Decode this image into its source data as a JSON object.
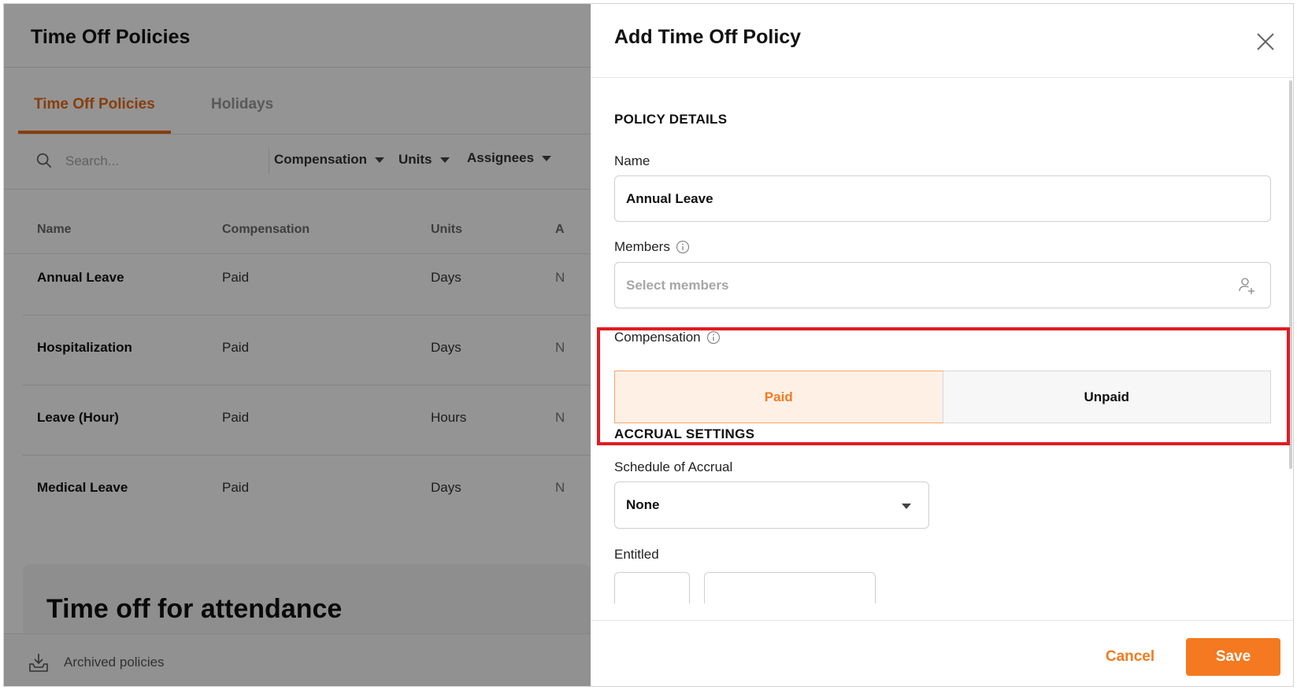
{
  "page": {
    "title": "Time Off Policies",
    "tabs": [
      {
        "label": "Time Off Policies",
        "active": true
      },
      {
        "label": "Holidays",
        "active": false
      }
    ],
    "search_placeholder": "Search...",
    "filters": [
      "Compensation",
      "Units",
      "Assignees"
    ],
    "table": {
      "columns": [
        "Name",
        "Compensation",
        "Units",
        "A"
      ],
      "rows": [
        {
          "name": "Annual Leave",
          "compensation": "Paid",
          "units": "Days",
          "more": "N"
        },
        {
          "name": "Hospitalization",
          "compensation": "Paid",
          "units": "Days",
          "more": "N"
        },
        {
          "name": "Leave (Hour)",
          "compensation": "Paid",
          "units": "Hours",
          "more": "N"
        },
        {
          "name": "Medical Leave",
          "compensation": "Paid",
          "units": "Days",
          "more": "N"
        }
      ]
    },
    "attendance_title": "Time off for attendance",
    "archived_label": "Archived policies"
  },
  "drawer": {
    "title": "Add Time Off Policy",
    "policy_section": "POLICY DETAILS",
    "name_label": "Name",
    "name_value": "Annual Leave",
    "members_label": "Members",
    "members_placeholder": "Select members",
    "compensation_label": "Compensation",
    "compensation_options": [
      {
        "label": "Paid",
        "selected": true
      },
      {
        "label": "Unpaid",
        "selected": false
      }
    ],
    "accrual_section": "ACCRUAL SETTINGS",
    "schedule_label": "Schedule of Accrual",
    "schedule_value": "None",
    "entitled_label": "Entitled",
    "cancel_label": "Cancel",
    "save_label": "Save"
  },
  "colors": {
    "accent": "#f47920",
    "highlight": "#e11b22",
    "selected_bg": "#fff0e6"
  }
}
